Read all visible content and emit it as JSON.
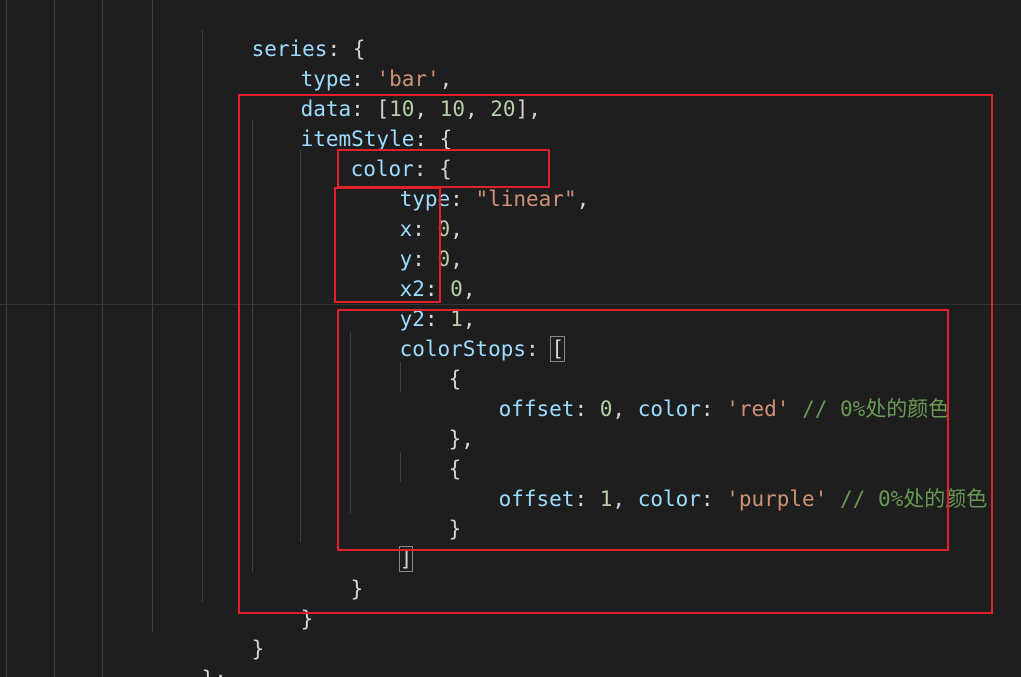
{
  "editor": {
    "theme": "dark",
    "colors": {
      "background": "#1e1e1e",
      "property": "#9cdcfe",
      "punctuation": "#d4d4d4",
      "string": "#ce9178",
      "number": "#b5cea8",
      "comment": "#6a9955",
      "highlight_box": "#e0202a"
    },
    "code": {
      "l1": {
        "t1": "series",
        "t2": ": {"
      },
      "l2": {
        "t1": "type",
        "t2": ": ",
        "t3": "'bar'",
        "t4": ","
      },
      "l3": {
        "t1": "data",
        "t2": ": [",
        "t3": "10",
        "t4": ", ",
        "t5": "10",
        "t6": ", ",
        "t7": "20",
        "t8": "],"
      },
      "l4": {
        "t1": "itemStyle",
        "t2": ": {"
      },
      "l5": {
        "t1": "color",
        "t2": ": {"
      },
      "l6": {
        "t1": "type",
        "t2": ": ",
        "t3": "\"linear\"",
        "t4": ","
      },
      "l7": {
        "t1": "x",
        "t2": ": ",
        "t3": "0",
        "t4": ","
      },
      "l8": {
        "t1": "y",
        "t2": ": ",
        "t3": "0",
        "t4": ","
      },
      "l9": {
        "t1": "x2",
        "t2": ": ",
        "t3": "0",
        "t4": ","
      },
      "l10": {
        "t1": "y2",
        "t2": ": ",
        "t3": "1",
        "t4": ","
      },
      "l11": {
        "t1": "colorStops",
        "t2": ": ",
        "t3": "["
      },
      "l12": {
        "t1": "{"
      },
      "l13": {
        "t1": "offset",
        "t2": ": ",
        "t3": "0",
        "t4": ", ",
        "t5": "color",
        "t6": ": ",
        "t7": "'red'",
        "t8": " ",
        "t9": "// 0%处的颜色"
      },
      "l14": {
        "t1": "},"
      },
      "l15": {
        "t1": "{"
      },
      "l16": {
        "t1": "offset",
        "t2": ": ",
        "t3": "1",
        "t4": ", ",
        "t5": "color",
        "t6": ": ",
        "t7": "'purple'",
        "t8": " ",
        "t9": "// 0%处的颜色"
      },
      "l17": {
        "t1": "}"
      },
      "l18": {
        "t1": "]"
      },
      "l19": {
        "t1": "}"
      },
      "l20": {
        "t1": "}"
      },
      "l21": {
        "t1": "}"
      },
      "l22": {
        "t1": "};"
      }
    }
  }
}
